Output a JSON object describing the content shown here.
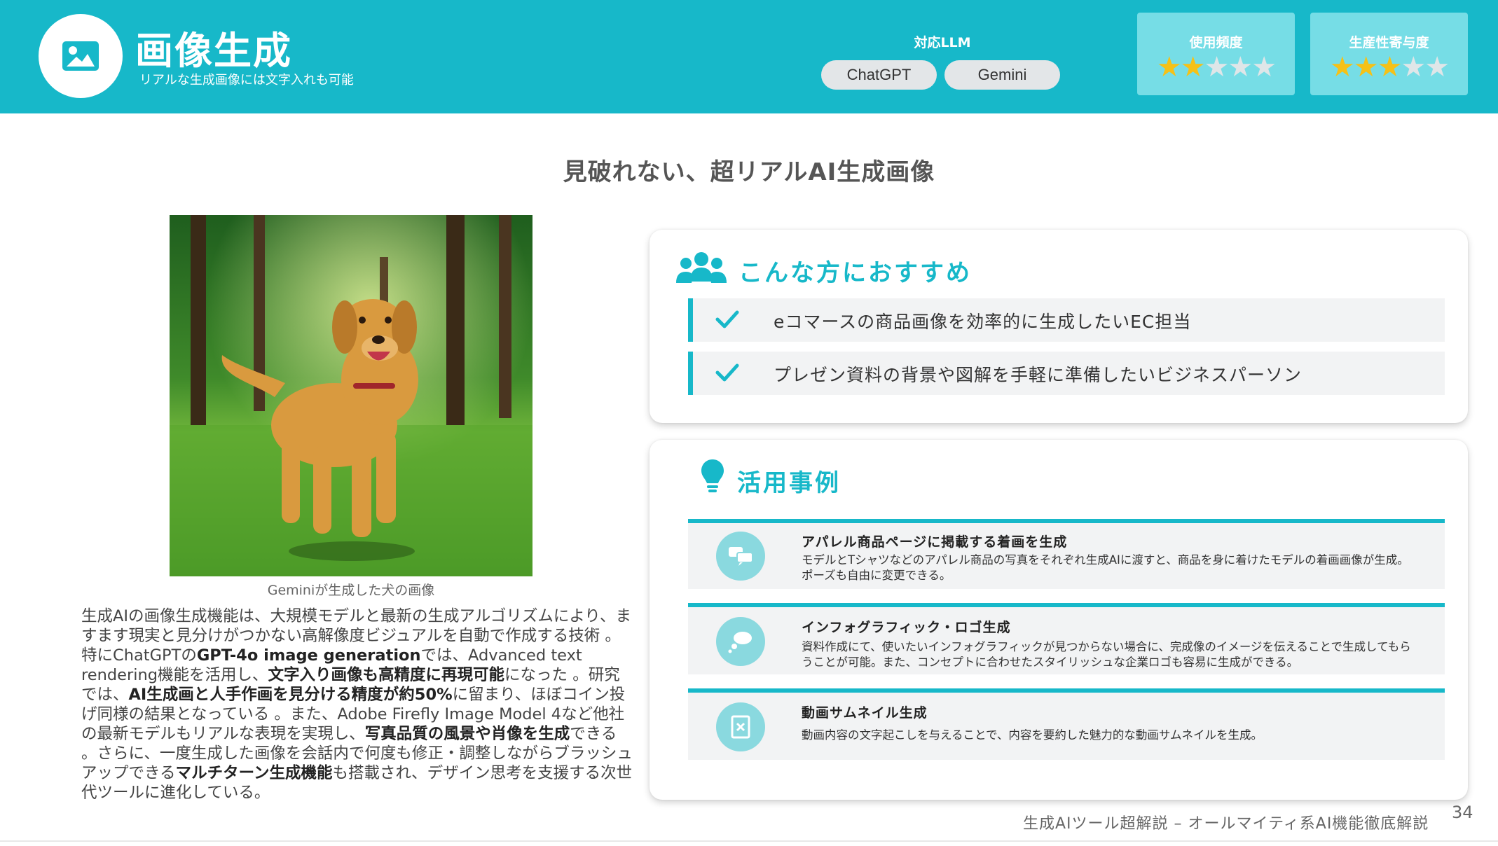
{
  "header": {
    "title": "画像生成",
    "subtitle": "リアルな生成画像には文字入れも可能",
    "llm_label": "対応LLM",
    "llms": [
      "ChatGPT",
      "Gemini"
    ],
    "ratings": [
      {
        "label": "使用頻度",
        "stars": 2,
        "max": 5
      },
      {
        "label": "生産性寄与度",
        "stars": 3,
        "max": 5
      }
    ],
    "icon": "image-icon"
  },
  "section_heading": "見破れない、超リアルAI生成画像",
  "image": {
    "caption": "Geminiが生成した犬の画像"
  },
  "body": {
    "p1": "生成AIの画像生成機能は、大規模モデルと最新の生成アルゴリズムにより、ますます現実と見分けがつかない高解像度ビジュアルを自動で作成する技術 。特にChatGPTの",
    "b1": "GPT-4o image generation",
    "p2": "では、Advanced text rendering機能を活用し、",
    "b2": "文字入り画像も高精度に再現可能",
    "p3": "になった 。研究では、",
    "b3": "AI生成画と人手作画を見分ける精度が約50%",
    "p4": "に留まり、ほぼコイン投げ同様の結果となっている 。また、Adobe Firefly Image Model 4など他社の最新モデルもリアルな表現を実現し、",
    "b4": "写真品質の風景や肖像を生成",
    "p5": "できる 。さらに、一度生成した画像を会話内で何度も修正・調整しながらブラッシュアップできる",
    "b5": "マルチターン生成機能",
    "p6": "も搭載され、デザイン思考を支援する次世代ツールに進化している。"
  },
  "recommend": {
    "title": "こんな方におすすめ",
    "icon": "users-icon",
    "items": [
      "eコマースの商品画像を効率的に生成したいEC担当",
      "プレゼン資料の背景や図解を手軽に準備したいビジネスパーソン"
    ]
  },
  "cases": {
    "title": "活用事例",
    "icon": "lightbulb-icon",
    "items": [
      {
        "title": "アパレル商品ページに掲載する着画を生成",
        "desc": "モデルとTシャツなどのアパレル商品の写真をそれぞれ生成AIに渡すと、商品を身に着けたモデルの着画画像が生成。ポーズも自由に変更できる。",
        "icon": "chat-bubbles-icon"
      },
      {
        "title": "インフォグラフィック・ロゴ生成",
        "desc": "資料作成にて、使いたいインフォグラフィックが見つからない場合に、完成像のイメージを伝えることで生成してもらうことが可能。また、コンセプトに合わせたスタイリッシュな企業ロゴも容易に生成ができる。",
        "icon": "thought-bubble-icon"
      },
      {
        "title": "動画サムネイル生成",
        "desc": "動画内容の文字起こしを与えることで、内容を要約した魅力的な動画サムネイルを生成。",
        "icon": "document-icon"
      }
    ]
  },
  "colors": {
    "accent": "#17b8c9",
    "star": "#f5c117"
  },
  "footer": {
    "text": "生成AIツール超解説 – オールマイティ系AI機能徹底解説",
    "page": "34"
  }
}
